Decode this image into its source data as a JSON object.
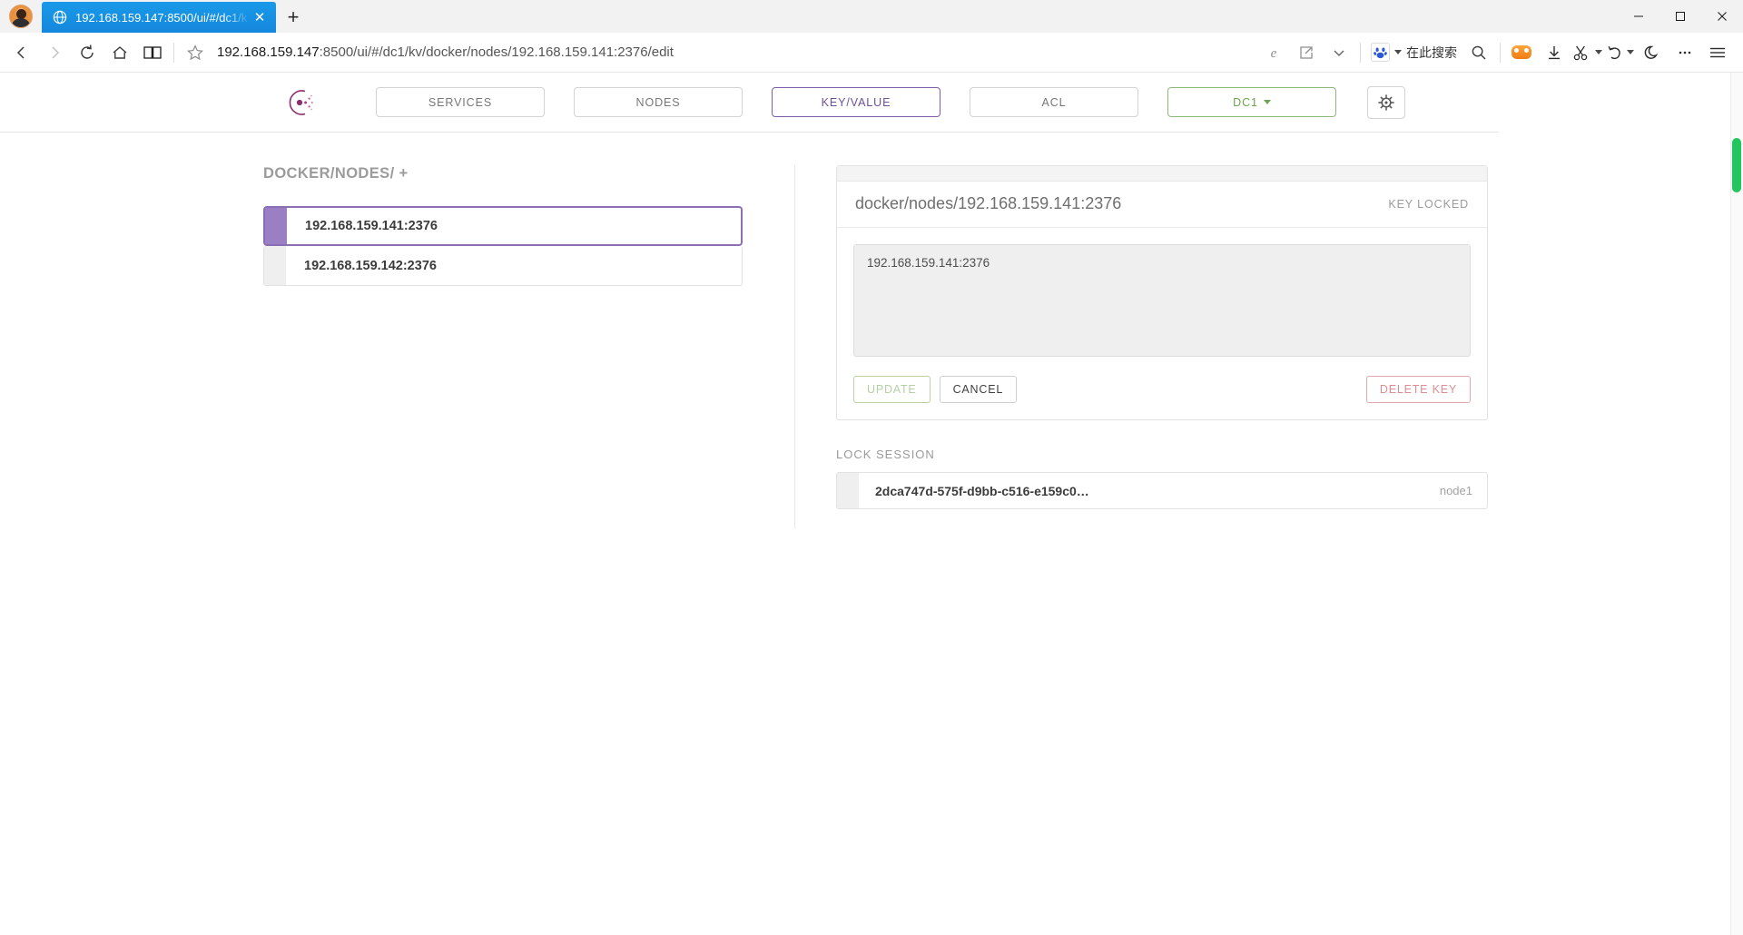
{
  "browser": {
    "tab": {
      "title": "192.168.159.147:8500/ui/#/dc1/k",
      "close_label": "✕",
      "globe_icon": "globe-icon"
    },
    "newtab_label": "+",
    "window_controls": {
      "minimize": "—",
      "maximize": "▢",
      "close": "✕"
    },
    "nav": {
      "back": "back-arrow-icon",
      "forward": "forward-arrow-icon",
      "reload": "reload-icon",
      "home": "home-icon",
      "reading_list": "book-icon",
      "favorite": "star-icon"
    },
    "url": {
      "host": "192.168.159.147",
      "path": ":8500/ui/#/dc1/kv/docker/nodes/192.168.159.141:2376/edit",
      "full": "192.168.159.147:8500/ui/#/dc1/kv/docker/nodes/192.168.159.141:2376/edit"
    },
    "toolbar": {
      "ie_mode": "internet-explorer-icon",
      "share": "share-icon",
      "chevron": "chevron-down-icon",
      "search_engine_label": "在此搜索",
      "search": "search-icon",
      "games": "games-icon",
      "downloads": "download-icon",
      "collections": "scissors-icon",
      "history": "undo-icon",
      "dark_mode": "moon-icon",
      "more": "ellipsis-icon",
      "menu": "hamburger-menu-icon"
    }
  },
  "app": {
    "logo": "consul-logo-icon",
    "nav_items": [
      {
        "label": "SERVICES",
        "active": false
      },
      {
        "label": "NODES",
        "active": false
      },
      {
        "label": "KEY/VALUE",
        "active": true
      },
      {
        "label": "ACL",
        "active": false
      }
    ],
    "datacenter": {
      "label": "DC1",
      "caret": "caret-down-icon"
    },
    "settings_icon": "gear-icon"
  },
  "main": {
    "breadcrumb": "DOCKER/NODES/ +",
    "kv_items": [
      {
        "label": "192.168.159.141:2376",
        "selected": true
      },
      {
        "label": "192.168.159.142:2376",
        "selected": false
      }
    ],
    "detail": {
      "key_name": "docker/nodes/192.168.159.141:2376",
      "locked_label": "KEY LOCKED",
      "value": "192.168.159.141:2376",
      "buttons": {
        "update": "UPDATE",
        "cancel": "CANCEL",
        "delete": "DELETE KEY"
      }
    },
    "lock_session": {
      "title": "LOCK SESSION",
      "session_id": "2dca747d-575f-d9bb-c516-e159c0…",
      "node": "node1"
    }
  },
  "colors": {
    "accent_purple": "#7b5ea7",
    "accent_green": "#6aa54f",
    "danger_red": "#dd8e92",
    "tab_blue": "#1487dd"
  }
}
